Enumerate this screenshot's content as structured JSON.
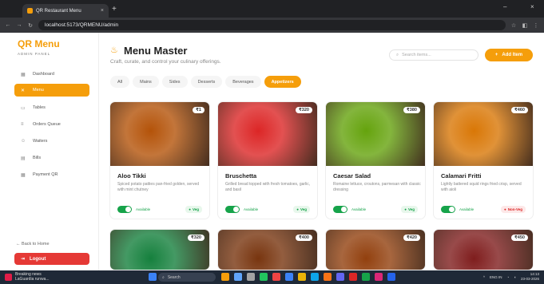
{
  "browser": {
    "tab_title": "QR Restaurant Menu",
    "tab_close": "×",
    "new_tab": "+",
    "minimize": "–",
    "close": "×",
    "url": "localhost:5173/QRMENU/admin"
  },
  "sidebar": {
    "brand": "QR Menu",
    "brand_sub": "ADMIN PANEL",
    "items": [
      {
        "label": "Dashboard",
        "icon": "▦"
      },
      {
        "label": "Menu",
        "icon": "✕"
      },
      {
        "label": "Tables",
        "icon": "▭"
      },
      {
        "label": "Orders Queue",
        "icon": "≡"
      },
      {
        "label": "Waiters",
        "icon": "☺"
      },
      {
        "label": "Bills",
        "icon": "▤"
      },
      {
        "label": "Payment QR",
        "icon": "▦"
      }
    ],
    "back": "← Back to Home",
    "logout": "Logout"
  },
  "header": {
    "title": "Menu Master",
    "subtitle": "Craft, curate, and control your culinary offerings.",
    "search_placeholder": "Search items...",
    "add_button": "Add Item"
  },
  "categories": [
    {
      "label": "All",
      "active": false
    },
    {
      "label": "Mains",
      "active": false
    },
    {
      "label": "Sides",
      "active": false
    },
    {
      "label": "Desserts",
      "active": false
    },
    {
      "label": "Beverages",
      "active": false
    },
    {
      "label": "Appetizers",
      "active": true
    }
  ],
  "cards": [
    {
      "name": "Aloo Tikki",
      "price": "₹1",
      "desc": "Spiced potato patties pan-fried golden, served with mint chutney",
      "status": "Available",
      "badge": "Veg",
      "veg": true,
      "color": "#b45309"
    },
    {
      "name": "Bruschetta",
      "price": "₹320",
      "desc": "Grilled bread topped with fresh tomatoes, garlic, and basil",
      "status": "Available",
      "badge": "Veg",
      "veg": true,
      "color": "#dc2626"
    },
    {
      "name": "Caesar Salad",
      "price": "₹380",
      "desc": "Romaine lettuce, croutons, parmesan with classic dressing",
      "status": "Available",
      "badge": "Veg",
      "veg": true,
      "color": "#65a30d"
    },
    {
      "name": "Calamari Fritti",
      "price": "₹460",
      "desc": "Lightly battered squid rings fried crisp, served with aioli",
      "status": "Available",
      "badge": "Non-Veg",
      "veg": false,
      "color": "#d97706"
    },
    {
      "price": "₹320",
      "color": "#15803d"
    },
    {
      "price": "₹400",
      "color": "#78350f"
    },
    {
      "price": "₹420",
      "color": "#92400e"
    },
    {
      "price": "₹450",
      "color": "#7f1d1d"
    }
  ],
  "taskbar": {
    "news_title": "Breaking news",
    "news_sub": "LaGuardia runwa...",
    "search": "Search",
    "lang": "ENG IN",
    "time": "14:13",
    "date": "23-03-2026"
  },
  "colors": {
    "accent": "#f59e0b",
    "danger": "#e53935",
    "success": "#16a34a"
  }
}
